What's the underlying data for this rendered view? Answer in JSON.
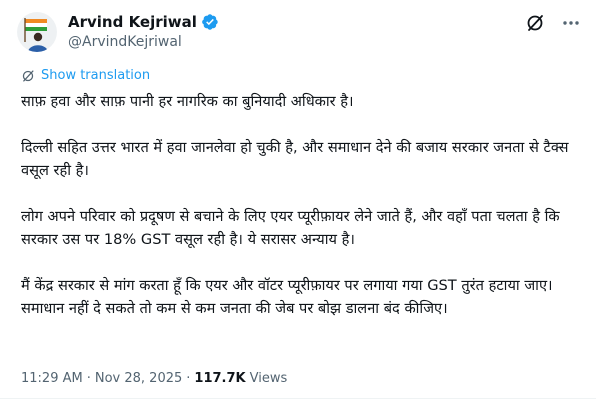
{
  "author": {
    "display_name": "Arvind Kejriwal",
    "handle": "@ArvindKejriwal",
    "verified": true
  },
  "actions": {
    "grok_icon": "slash-circle-icon",
    "more_icon": "more-horizontal-icon"
  },
  "translate": {
    "label": "Show translation"
  },
  "tweet": {
    "paragraphs": [
      "साफ़ हवा और साफ़ पानी हर नागरिक का बुनियादी अधिकार है।",
      "दिल्ली सहित उत्तर भारत में हवा जानलेवा हो चुकी है, और समाधान देने की बजाय सरकार जनता से टैक्स वसूल रही है।",
      "लोग अपने परिवार को प्रदूषण से बचाने के लिए एयर प्यूरीफ़ायर लेने जाते हैं, और वहाँ पता चलता है कि सरकार उस पर 18% GST वसूल रही है। ये सरासर अन्याय है।",
      "मैं केंद्र सरकार से मांग करता हूँ कि एयर और वॉटर प्यूरीफ़ायर पर लगाया गया GST तुरंत हटाया जाए। समाधान नहीं दे सकते तो कम से कम जनता की जेब पर बोझ डालना बंद कीजिए।"
    ]
  },
  "meta": {
    "time": "11:29 AM",
    "separator": "·",
    "date": "Nov 28, 2025",
    "views_count": "117.7K",
    "views_label": "Views"
  },
  "colors": {
    "text": "#0f1419",
    "secondary": "#536471",
    "accent": "#1d9bf0"
  }
}
